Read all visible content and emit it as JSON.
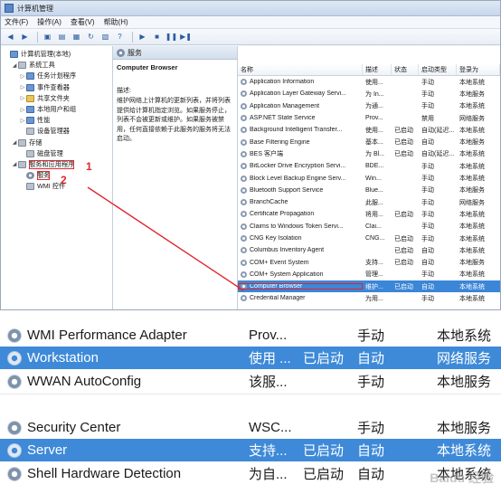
{
  "window": {
    "title": "计算机管理"
  },
  "menu": [
    "文件(F)",
    "操作(A)",
    "查看(V)",
    "帮助(H)"
  ],
  "tree": [
    {
      "label": "计算机管理(本地)",
      "indent": 0,
      "arrow": "",
      "icon": "blue"
    },
    {
      "label": "系统工具",
      "indent": 1,
      "arrow": "◢",
      "icon": "gray"
    },
    {
      "label": "任务计划程序",
      "indent": 2,
      "arrow": "▷",
      "icon": "blue"
    },
    {
      "label": "事件查看器",
      "indent": 2,
      "arrow": "▷",
      "icon": "blue"
    },
    {
      "label": "共享文件夹",
      "indent": 2,
      "arrow": "▷",
      "icon": "yel"
    },
    {
      "label": "本地用户和组",
      "indent": 2,
      "arrow": "▷",
      "icon": "blue"
    },
    {
      "label": "性能",
      "indent": 2,
      "arrow": "▷",
      "icon": "blue"
    },
    {
      "label": "设备管理器",
      "indent": 2,
      "arrow": "",
      "icon": "gray"
    },
    {
      "label": "存储",
      "indent": 1,
      "arrow": "◢",
      "icon": "gray"
    },
    {
      "label": "磁盘管理",
      "indent": 2,
      "arrow": "",
      "icon": "gray"
    },
    {
      "label": "服务和应用程序",
      "indent": 1,
      "arrow": "◢",
      "icon": "gray",
      "highlight": true
    },
    {
      "label": "服务",
      "indent": 2,
      "arrow": "",
      "icon": "gear",
      "highlight": true
    },
    {
      "label": "WMI 控件",
      "indent": 2,
      "arrow": "",
      "icon": "gray"
    }
  ],
  "callouts": [
    "1",
    "2"
  ],
  "middle": {
    "header": "服务",
    "title": "Computer Browser",
    "desc_label": "描述:",
    "desc": "维护网络上计算机的更新列表，并将列表提供给计算机指定浏览。如果服务停止，列表不会被更新或维护。如果服务被禁用，任何直接依赖于此服务的服务将无法启动。"
  },
  "columns": [
    "名称",
    "描述",
    "状态",
    "启动类型",
    "登录为"
  ],
  "services": [
    [
      "Application Information",
      "使用...",
      "",
      "手动",
      "本地系统"
    ],
    [
      "Application Layer Gateway Servi...",
      "为 In...",
      "",
      "手动",
      "本地服务"
    ],
    [
      "Application Management",
      "为通...",
      "",
      "手动",
      "本地系统"
    ],
    [
      "ASP.NET State Service",
      "Prov...",
      "",
      "禁用",
      "网络服务"
    ],
    [
      "Background Intelligent Transfer...",
      "使用...",
      "已启动",
      "自动(延迟...",
      "本地系统"
    ],
    [
      "Base Filtering Engine",
      "基本...",
      "已启动",
      "自动",
      "本地服务"
    ],
    [
      "BES 客户端",
      "为 Bl...",
      "已启动",
      "自动(延迟...",
      "本地系统"
    ],
    [
      "BitLocker Drive Encryption Servi...",
      "BDE...",
      "",
      "手动",
      "本地系统"
    ],
    [
      "Block Level Backup Engine Serv...",
      "Win...",
      "",
      "手动",
      "本地系统"
    ],
    [
      "Bluetooth Support Service",
      "Blue...",
      "",
      "手动",
      "本地服务"
    ],
    [
      "BranchCache",
      "此服...",
      "",
      "手动",
      "网络服务"
    ],
    [
      "Certificate Propagation",
      "将用...",
      "已启动",
      "手动",
      "本地系统"
    ],
    [
      "Claims to Windows Token Servi...",
      "Clai...",
      "",
      "手动",
      "本地系统"
    ],
    [
      "CNG Key Isolation",
      "CNG...",
      "已启动",
      "手动",
      "本地系统"
    ],
    [
      "Columbus Inventory Agent",
      "",
      "已启动",
      "自动",
      "本地系统"
    ],
    [
      "COM+ Event System",
      "支持...",
      "已启动",
      "自动",
      "本地服务"
    ],
    [
      "COM+ System Application",
      "管理...",
      "",
      "手动",
      "本地系统"
    ],
    [
      "Computer Browser",
      "维护...",
      "已启动",
      "自动",
      "本地系统"
    ],
    [
      "Credential Manager",
      "为用...",
      "",
      "手动",
      "本地系统"
    ]
  ],
  "selected_service_index": 17,
  "zoom_rows": [
    [
      "WMI Performance Adapter",
      "Prov...",
      "",
      "手动",
      "本地系统"
    ],
    [
      "Workstation",
      "使用 ...",
      "已启动",
      "自动",
      "网络服务"
    ],
    [
      "WWAN AutoConfig",
      "该服...",
      "",
      "手动",
      "本地服务"
    ],
    [
      "Security Center",
      "WSC...",
      "",
      "手动",
      "本地服务"
    ],
    [
      "Server",
      "支持...",
      "已启动",
      "自动",
      "本地系统"
    ],
    [
      "Shell Hardware Detection",
      "为自...",
      "已启动",
      "自动",
      "本地系统"
    ]
  ],
  "watermark": "Baidu 经验"
}
